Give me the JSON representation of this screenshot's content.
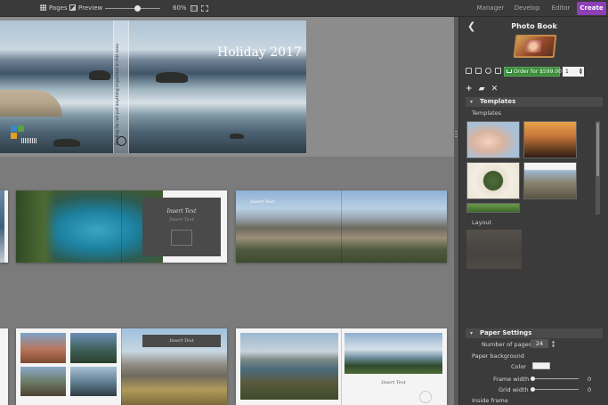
{
  "topbar": {
    "pages_label": "Pages",
    "preview_label": "Preview",
    "zoom_level": "60%",
    "fit_label": "1:1",
    "tabs": [
      {
        "label": "Manager",
        "active": false
      },
      {
        "label": "Develop",
        "active": false
      },
      {
        "label": "Editor",
        "active": false
      },
      {
        "label": "Create",
        "active": true
      }
    ]
  },
  "cover": {
    "title": "Holiday 2017",
    "spine_text": "Binding   Do not put anything important in this area"
  },
  "spreads": {
    "textbox_main": "Insert Text",
    "textbox_sub": "Insert Text"
  },
  "panel": {
    "title": "Photo Book",
    "order_label": "Order for $599.00",
    "quantity": "1",
    "action_icons": "+ ▰ ✕",
    "templates_header": "Templates",
    "templates_label": "Templates",
    "layout_label": "Layout",
    "paper_header": "Paper Settings",
    "num_pages_label": "Number of pages",
    "num_pages_value": "24",
    "paper_bg_label": "Paper background",
    "color_label": "Color",
    "frame_width_label": "Frame width",
    "frame_width_value": "0",
    "grid_width_label": "Grid width",
    "grid_width_value": "0",
    "inside_frame_label": "Inside frame"
  },
  "colors": {
    "accent": "#8d3fb6",
    "order_green": "#3d8c3d"
  }
}
